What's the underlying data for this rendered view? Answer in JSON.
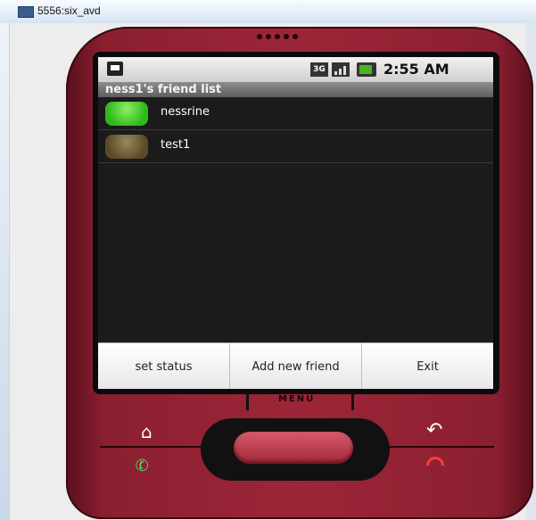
{
  "window": {
    "title": "5556:six_avd"
  },
  "statusbar": {
    "network": "3G",
    "time": "2:55 AM"
  },
  "app": {
    "title": "ness1's friend list"
  },
  "friends": [
    {
      "name": "nessrine",
      "status_color": "#3fcf2a"
    },
    {
      "name": "test1",
      "status_color": "#6b5a35"
    }
  ],
  "menu": {
    "items": [
      "set status",
      "Add new friend",
      "Exit"
    ]
  },
  "hardware": {
    "menu_label": "MENU"
  }
}
